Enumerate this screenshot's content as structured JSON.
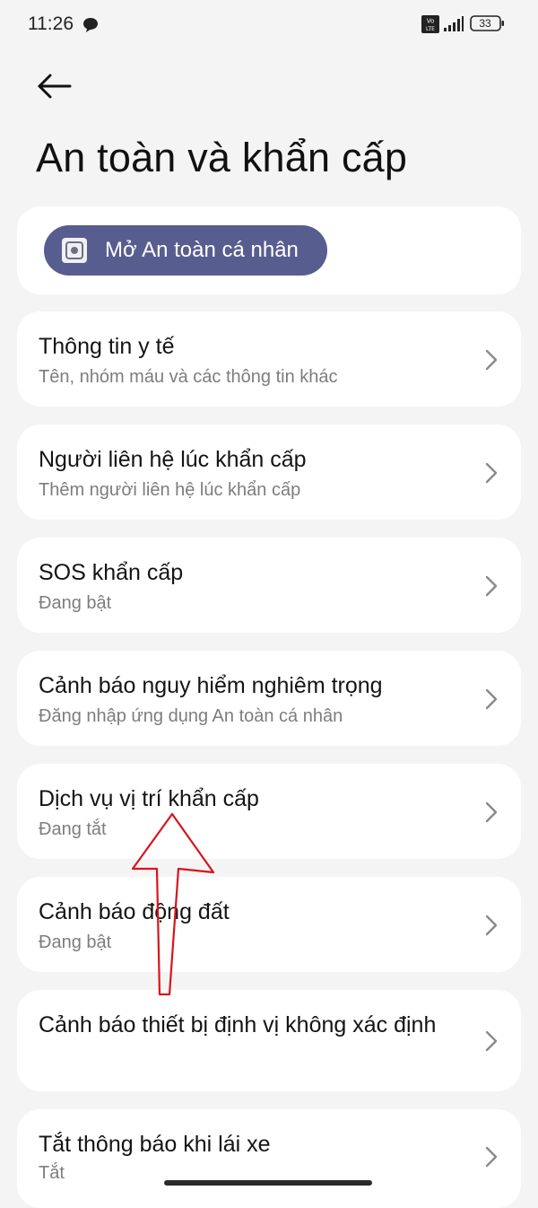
{
  "status_bar": {
    "time": "11:26",
    "icons": [
      "message-bubble-icon",
      "volte-icon",
      "signal-icon",
      "battery-icon"
    ],
    "network_badge": [
      "Vo",
      "LTE"
    ],
    "battery_level": "33"
  },
  "header": {
    "back_icon": "arrow-left-icon",
    "title": "An toàn và khẩn cấp"
  },
  "top_card": {
    "button_label": "Mở An toàn cá nhân",
    "button_icon": "personal-safety-app-icon",
    "button_color": "#585d8f"
  },
  "items": [
    {
      "title": "Thông tin y tế",
      "subtitle": "Tên, nhóm máu và các thông tin khác"
    },
    {
      "title": "Người liên hệ lúc khẩn cấp",
      "subtitle": "Thêm người liên hệ lúc khẩn cấp"
    },
    {
      "title": "SOS khẩn cấp",
      "subtitle": "Đang bật"
    },
    {
      "title": "Cảnh báo nguy hiểm nghiêm trọng",
      "subtitle": "Đăng nhập ứng dụng An toàn cá nhân"
    },
    {
      "title": "Dịch vụ vị trí khẩn cấp",
      "subtitle": "Đang tắt"
    },
    {
      "title": "Cảnh báo động đất",
      "subtitle": "Đang bật"
    },
    {
      "title": "Cảnh báo thiết bị định vị không xác định",
      "subtitle": ""
    },
    {
      "title": "Tắt thông báo khi lái xe",
      "subtitle": "Tắt"
    }
  ],
  "item_chevron_icon": "chevron-right-icon",
  "annotation": {
    "type": "red-arrow-up",
    "color": "#d8141e",
    "target": "Dịch vụ vị trí khẩn cấp"
  }
}
